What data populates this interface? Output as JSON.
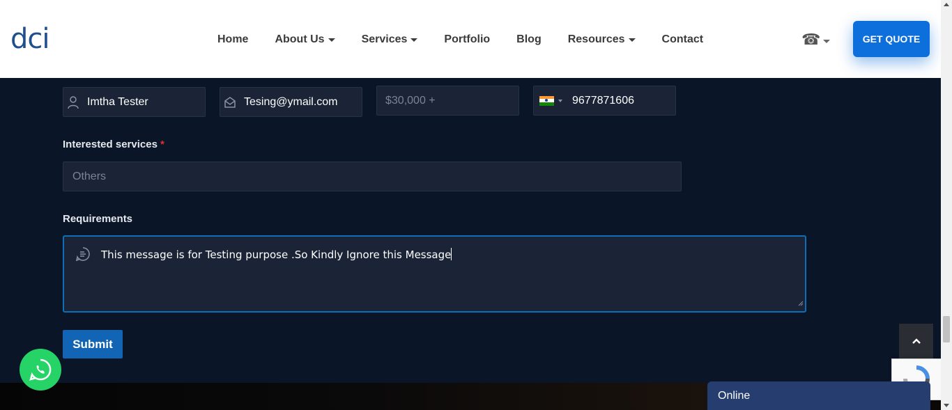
{
  "header": {
    "logo": "dci",
    "nav": [
      {
        "label": "Home",
        "has_dropdown": false
      },
      {
        "label": "About Us",
        "has_dropdown": true
      },
      {
        "label": "Services",
        "has_dropdown": true
      },
      {
        "label": "Portfolio",
        "has_dropdown": false
      },
      {
        "label": "Blog",
        "has_dropdown": false
      },
      {
        "label": "Resources",
        "has_dropdown": true
      },
      {
        "label": "Contact",
        "has_dropdown": false
      }
    ],
    "phone_icon": "phone-icon",
    "quote_button": "GET QUOTE"
  },
  "form": {
    "name_value": "Imtha Tester",
    "email_value": "Tesing@ymail.com",
    "budget_placeholder": "$30,000 +",
    "phone_value": "9677871606",
    "phone_country": "India",
    "services_label": "Interested services",
    "required_mark": "*",
    "services_placeholder": "Others",
    "requirements_label": "Requirements",
    "requirements_value": "This message is for Testing purpose .So Kindly Ignore this Message",
    "submit_label": "Submit"
  },
  "chat": {
    "status": "Online"
  },
  "colors": {
    "background": "#0b1528",
    "field": "#1a2436",
    "accent": "#0d6fdc",
    "submit": "#1265b4",
    "chat": "#263d70",
    "whatsapp": "#25d366"
  }
}
